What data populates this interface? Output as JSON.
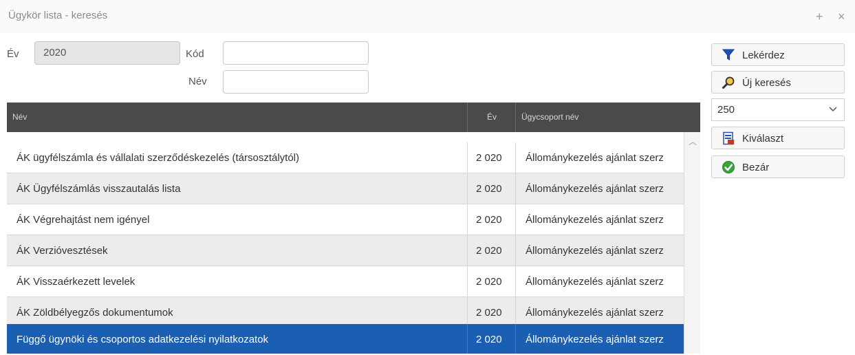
{
  "window": {
    "title": "Ügykör lista - keresés",
    "pin": "+",
    "close": "×"
  },
  "filter": {
    "ev_label": "Év",
    "ev_value": "2020",
    "kod_label": "Kód",
    "kod_value": "",
    "nev_label": "Név",
    "nev_value": ""
  },
  "grid": {
    "columns": [
      "Név",
      "Év",
      "Ügycsoport név"
    ],
    "rows": [
      {
        "nev": "ÁK ügyfélszámla és vállalati szerződéskezelés (társosztálytól)",
        "ev": "2 020",
        "csoport": "Állománykezelés ajánlat szerz"
      },
      {
        "nev": "ÁK Ügyfélszámlás visszautalás lista",
        "ev": "2 020",
        "csoport": "Állománykezelés ajánlat szerz"
      },
      {
        "nev": "ÁK Végrehajtást nem igényel",
        "ev": "2 020",
        "csoport": "Állománykezelés ajánlat szerz"
      },
      {
        "nev": "ÁK Verzióvesztések",
        "ev": "2 020",
        "csoport": "Állománykezelés ajánlat szerz"
      },
      {
        "nev": "ÁK Visszaérkezett levelek",
        "ev": "2 020",
        "csoport": "Állománykezelés ajánlat szerz"
      },
      {
        "nev": "ÁK Zöldbélyegzős dokumentumok",
        "ev": "2 020",
        "csoport": "Állománykezelés ajánlat szerz"
      },
      {
        "nev": "Függő ügynöki és csoportos adatkezelési nyilatkozatok",
        "ev": "2 020",
        "csoport": "Állománykezelés ajánlat szerz"
      }
    ],
    "selected_row": "Függő ügynöki és csoportos adatkezelési nyilatkozatok"
  },
  "actions": {
    "lekerdez": "Lekérdez",
    "uj_kereses": "Új keresés",
    "page_size": "250",
    "kivalaszt": "Kiválaszt",
    "bezar": "Bezár"
  },
  "colors": {
    "header_bg": "#4a4a4a",
    "selected_row": "#1b5fb3",
    "alt_row": "#ececec",
    "filter_icon": "#1f4fb5",
    "ok_icon": "#3aa53a"
  }
}
